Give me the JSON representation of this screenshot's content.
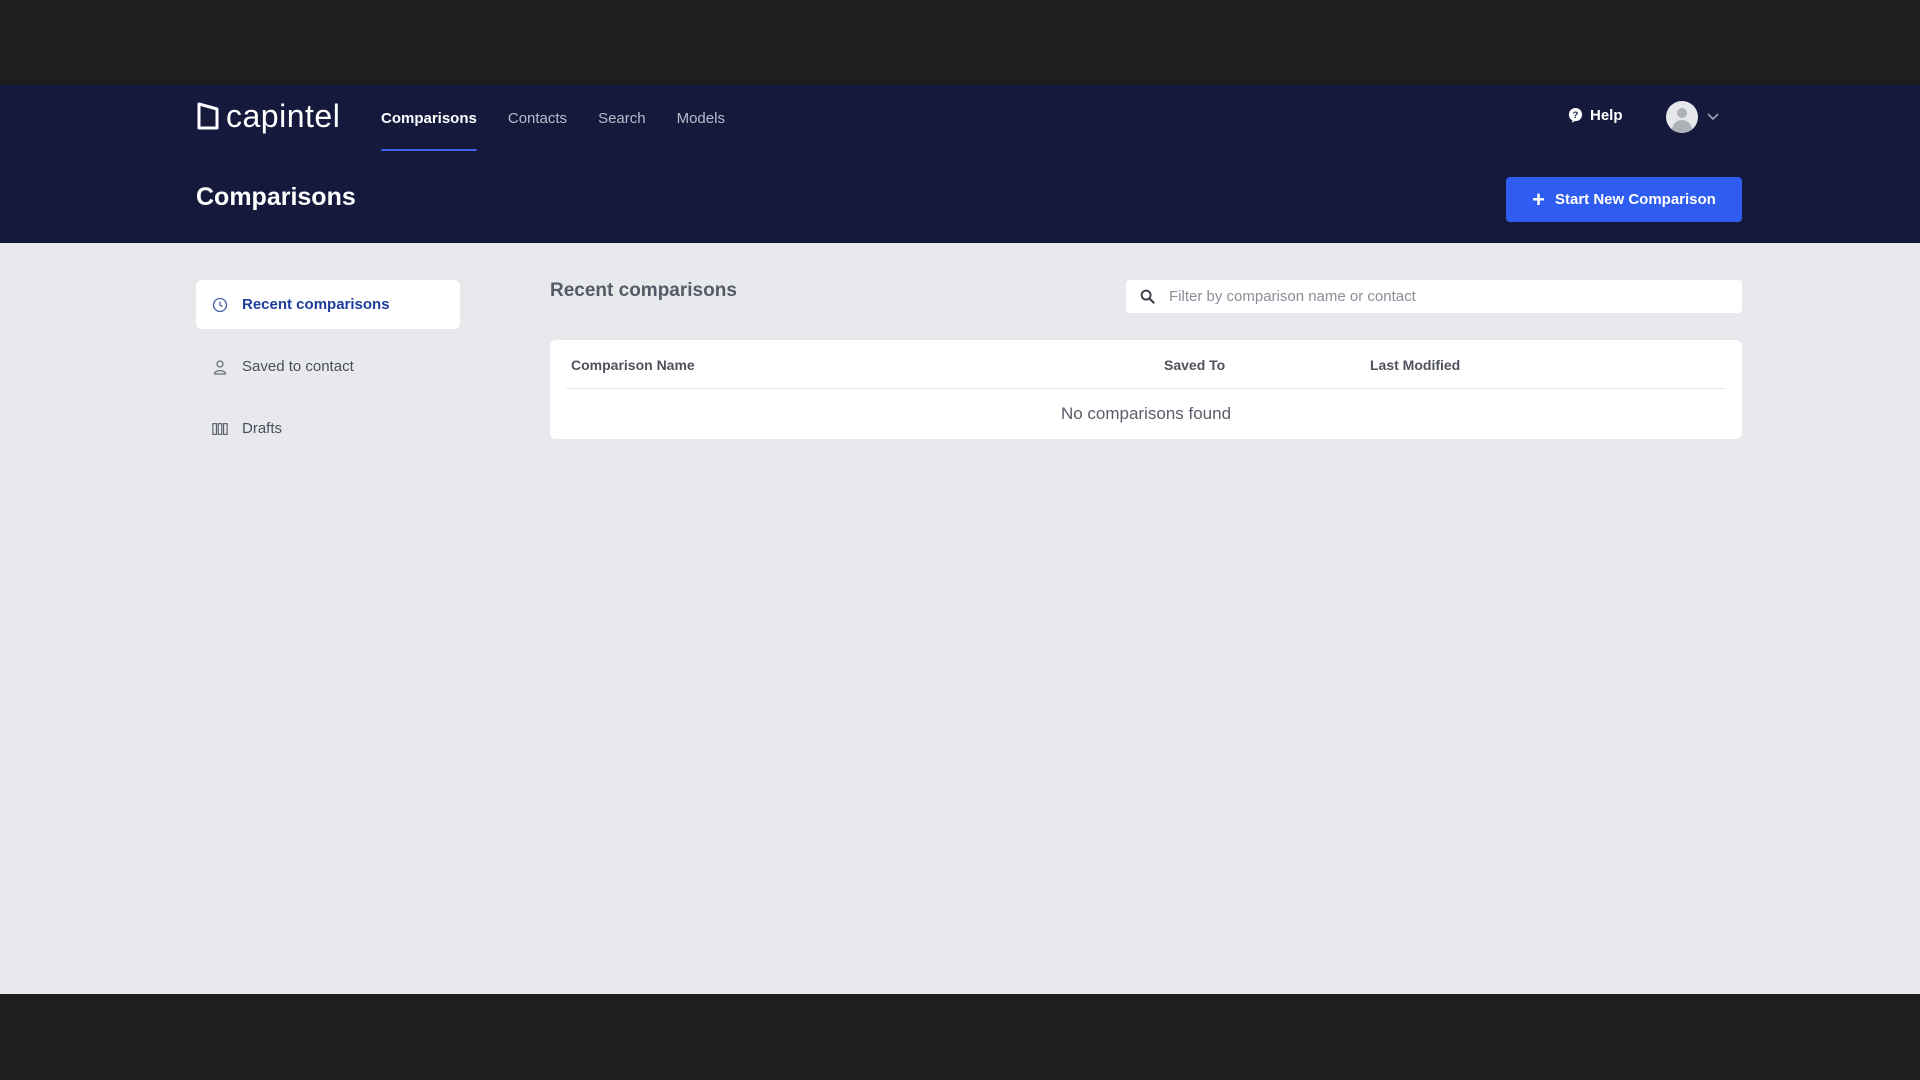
{
  "app": {
    "brand": "capintel"
  },
  "nav": {
    "items": [
      {
        "label": "Comparisons",
        "active": true
      },
      {
        "label": "Contacts"
      },
      {
        "label": "Search"
      },
      {
        "label": "Models"
      }
    ]
  },
  "header": {
    "help_label": "Help",
    "page_title": "Comparisons",
    "primary_button_label": "Start New Comparison"
  },
  "sidebar": {
    "items": [
      {
        "label": "Recent comparisons",
        "icon": "clock-icon",
        "active": true
      },
      {
        "label": "Saved to contact",
        "icon": "user-icon"
      },
      {
        "label": "Drafts",
        "icon": "drafts-icon"
      }
    ]
  },
  "main": {
    "section_title": "Recent comparisons",
    "search_placeholder": "Filter by comparison name or contact",
    "table": {
      "columns": [
        "Comparison Name",
        "Saved To",
        "Last Modified"
      ],
      "empty_message": "No comparisons found"
    }
  },
  "colors": {
    "header_bg": "#151a3d",
    "accent": "#2f5cf1",
    "page_bg": "#e8e9ed"
  }
}
